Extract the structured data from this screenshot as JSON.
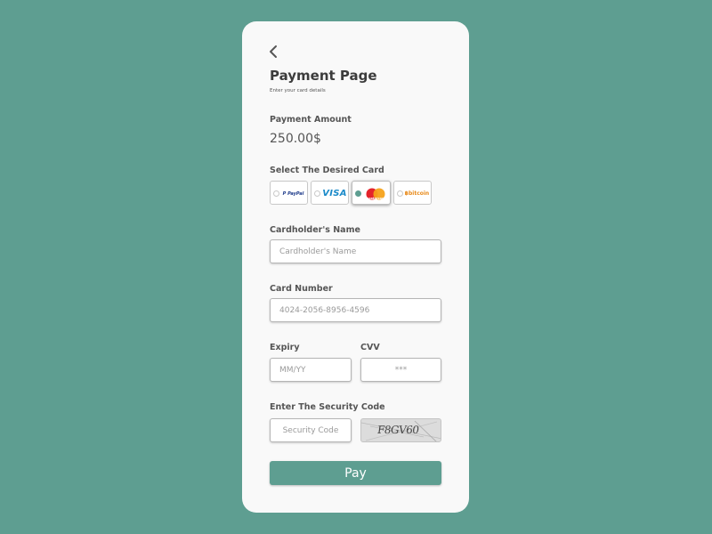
{
  "page": {
    "title": "Payment Page",
    "subtitle": "Enter your card details",
    "accent_color": "#5e9e91"
  },
  "navigation": {
    "back_icon": "chevron-left-icon"
  },
  "payment_amount": {
    "label": "Payment Amount",
    "value": "250.00$"
  },
  "card_select": {
    "label": "Select The Desired Card",
    "selected": "mastercard",
    "options": [
      {
        "id": "paypal",
        "logo_text": "PayPal",
        "selected": false
      },
      {
        "id": "visa",
        "logo_text": "VISA",
        "selected": false
      },
      {
        "id": "mastercard",
        "logo_text": "mastercard",
        "selected": true
      },
      {
        "id": "bitcoin",
        "logo_text": "bitcoin",
        "selected": false
      }
    ]
  },
  "form": {
    "cardholder": {
      "label": "Cardholder's Name",
      "placeholder": "Cardholder's Name",
      "value": ""
    },
    "card_number": {
      "label": "Card Number",
      "placeholder": "4024-2056-8956-4596",
      "value": ""
    },
    "expiry": {
      "label": "Expiry",
      "placeholder": "MM/YY",
      "value": ""
    },
    "cvv": {
      "label": "CVV",
      "placeholder": "***",
      "value": ""
    },
    "security": {
      "label": "Enter The Security Code",
      "placeholder": "Security Code",
      "value": "",
      "captcha_text": "F8GV60"
    }
  },
  "actions": {
    "pay_label": "Pay"
  }
}
